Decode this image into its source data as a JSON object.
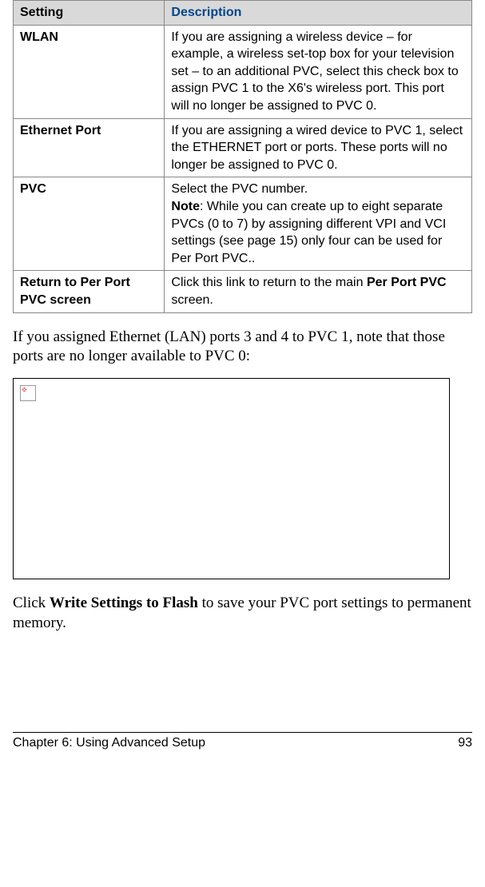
{
  "table": {
    "headers": {
      "setting": "Setting",
      "description": "Description"
    },
    "rows": [
      {
        "name": "WLAN",
        "desc": "If you are assigning a wireless device – for example, a wireless set-top box for your television set – to an additional PVC, select this check box to assign PVC 1 to the X6's wireless port. This port will no longer be assigned to PVC 0."
      },
      {
        "name": "Ethernet Port",
        "desc": "If you are assigning a wired device to PVC 1, select the ETHERNET port or ports. These ports will no longer be assigned to PVC 0."
      },
      {
        "name": "PVC",
        "desc_pre": "Select the PVC number.",
        "note_label": "Note",
        "desc_note": ": While you can create up to eight separate PVCs (0 to 7) by assigning different VPI and VCI settings (see page 15) only four can be used for Per Port PVC.."
      },
      {
        "name": "Return to Per Port PVC screen",
        "desc_pre": "Click this link to return to the main ",
        "desc_bold": "Per Port PVC",
        "desc_post": " screen."
      }
    ]
  },
  "para1": "If you assigned Ethernet (LAN) ports 3 and 4 to PVC 1, note that those ports are no longer available to PVC 0:",
  "para2_pre": "Click ",
  "para2_bold": "Write Settings to Flash",
  "para2_post": " to save your PVC port settings to permanent memory.",
  "footer": {
    "chapter": "Chapter 6: Using Advanced Setup",
    "page": "93"
  }
}
